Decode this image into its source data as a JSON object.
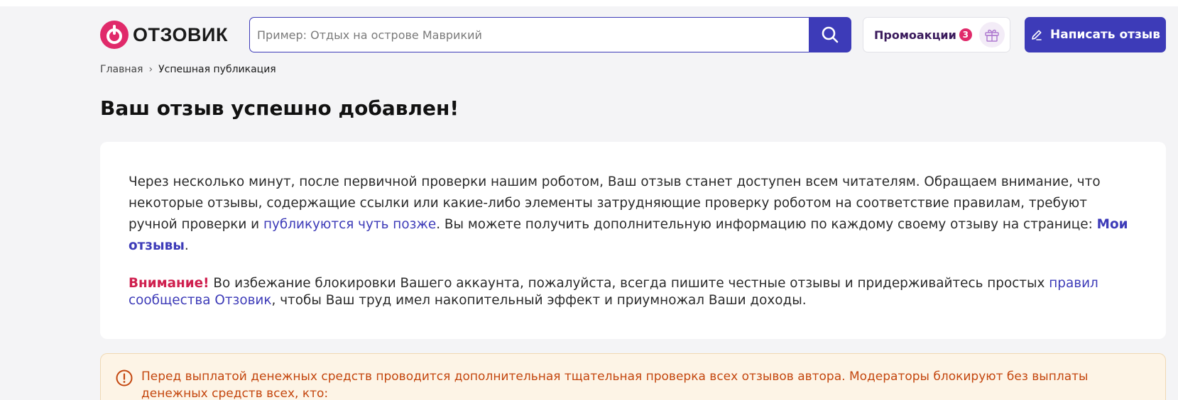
{
  "header": {
    "logo_text": "ОТЗОВИК",
    "search_placeholder": "Пример: Отдых на острове Маврикий",
    "promo_label": "Промоакции",
    "promo_count": "3",
    "write_review_label": "Написать отзыв"
  },
  "breadcrumb": {
    "home": "Главная",
    "separator": "›",
    "current": "Успешная публикация"
  },
  "page_title": "Ваш отзыв успешно добавлен!",
  "info_card": {
    "text_1": "Через несколько минут, после первичной проверки нашим роботом, Ваш отзыв станет доступен всем читателям. Обращаем внимание, что некоторые отзывы, содержащие ссылки или какие-либо элементы затрудняющие проверку роботом на соответствие правилам, требуют ручной проверки и ",
    "link_later": "публикуются чуть позже",
    "text_2": ". Вы можете получить дополнительную информацию по каждому своему отзыву на странице: ",
    "link_my_reviews": "Мои отзывы",
    "text_3": ".",
    "attention_label": "Внимание!",
    "attention_text": " Во избежание блокировки Вашего аккаунта, пожалуйста, всегда пишите честные отзывы и придерживайтесь простых ",
    "link_rules": "правил сообщества Отзовик",
    "attention_tail": ", чтобы Ваш труд имел накопительный эффект и приумножал Ваши доходы."
  },
  "warning": {
    "text": "Перед выплатой денежных средств проводится дополнительная тщательная проверка всех отзывов автора. Модераторы блокируют без выплаты денежных средств всех, кто:"
  },
  "colors": {
    "brand": "#e02a6a",
    "accent": "#3d3bb8",
    "warning_text": "#c4470f",
    "warning_bg": "#fdf4e6"
  }
}
